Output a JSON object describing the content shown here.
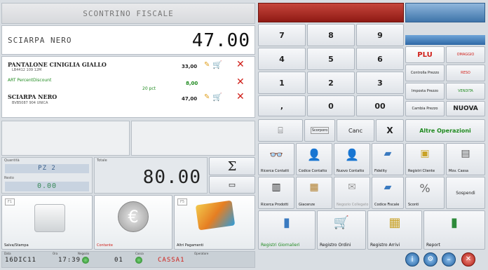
{
  "receipt": {
    "header": "SCONTRINO FISCALE",
    "current_item": "SCIARPA NERO",
    "current_price": "47.00",
    "lines": [
      {
        "name": "PANTALONE CINIGLIA GIALLO",
        "detail": "LB4412  109  12M",
        "price": "33,00"
      },
      {
        "name": "ART PercentDiscount",
        "detail": "20 pct",
        "price": "8,00"
      },
      {
        "name": "SCIARPA NERO",
        "detail": "BVB5087  904  UNICA",
        "price": "47,00"
      }
    ]
  },
  "totals": {
    "qty_label": "Quantità",
    "qty_value": "PZ 2",
    "total_label": "Totale",
    "total_value": "80.00",
    "change_label": "Resto",
    "change_value": "0.00"
  },
  "payments": {
    "receipt_print": "Salva/Stampa",
    "cash": "Contante",
    "other": "Altri Pagamenti"
  },
  "keypad": {
    "keys": [
      "7",
      "8",
      "9",
      "4",
      "5",
      "6",
      "1",
      "2",
      "3",
      ",",
      "0",
      "00"
    ]
  },
  "right_panel": {
    "plu": "PLU",
    "omaggio": "OMAGGIO",
    "controlla_prezzo": "Controlla Prezzo",
    "reso": "RESO",
    "imposta_prezzo": "Imposta Prezzo",
    "vendita": "VENDITA",
    "cambia_prezzo": "Cambia Prezzo",
    "nuova": "NUOVA"
  },
  "operations": {
    "buttons_row": [
      "",
      "Scorporo",
      "Canc",
      "X",
      "Altre Operazioni"
    ],
    "grid": [
      "Ricerca Contatti",
      "Codice Contatto",
      "Nuovo Contatto",
      "Fidelity",
      "Registri Cliente",
      "Mov. Cassa",
      "Ricerca Prodotti",
      "Giacenze",
      "Negozio Collegato",
      "Codice Fiscale",
      "Sconti",
      "Sospendi"
    ],
    "bottom": [
      "Registri Giornalieri",
      "Registro Ordini",
      "Registro Arrivi",
      "Report"
    ]
  },
  "status": {
    "date_label": "Data",
    "date_value": "16DIC11",
    "time_label": "Ora",
    "time_value": "17:39",
    "shop_label": "Negozio",
    "shop_value": "01",
    "cash_label": "Cassa",
    "cash_value": "CASSA1",
    "operator_label": "Operatore"
  },
  "colors": {
    "red_bar": "#b0241c",
    "blue_bar": "#5f93c4",
    "plu": "#d0201a"
  }
}
